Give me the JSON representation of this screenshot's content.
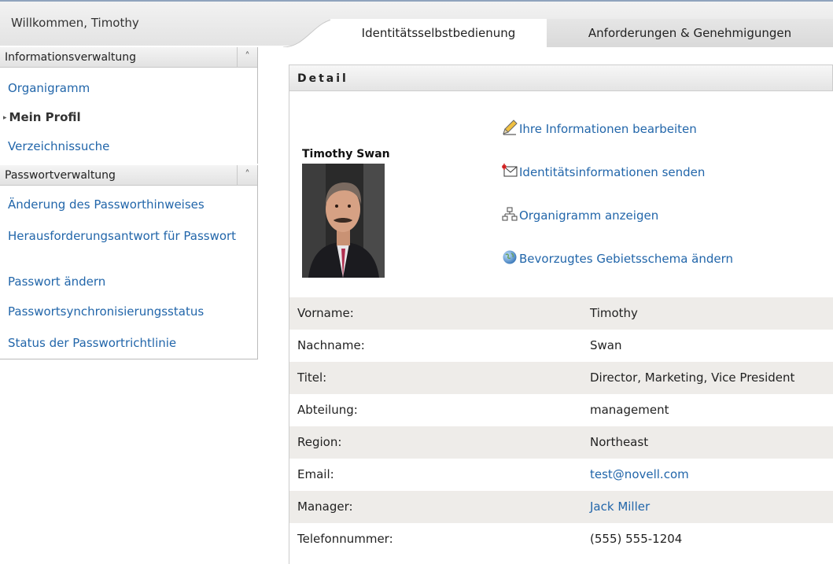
{
  "header": {
    "welcome": "Willkommen, Timothy",
    "tabs": [
      {
        "label": "Identitätsselbstbedienung",
        "active": true
      },
      {
        "label": "Anforderungen & Genehmigungen",
        "active": false
      }
    ]
  },
  "sidebar": {
    "groups": [
      {
        "title": "Informationsverwaltung",
        "items": [
          {
            "label": "Organigramm"
          },
          {
            "label": "Mein Profil",
            "current": true
          },
          {
            "label": "Verzeichnissuche"
          }
        ]
      },
      {
        "title": "Passwortverwaltung",
        "items": [
          {
            "label": "Änderung des Passworthinweises"
          },
          {
            "label": "Herausforderungsantwort für Passwort"
          },
          {
            "label": "Passwort ändern"
          },
          {
            "label": "Passwortsynchronisierungsstatus"
          },
          {
            "label": "Status der Passwortrichtlinie"
          }
        ]
      }
    ]
  },
  "detail": {
    "title": "Detail",
    "person_name": "Timothy Swan",
    "actions": [
      {
        "label": "Ihre Informationen bearbeiten",
        "icon": "pencil-icon"
      },
      {
        "label": "Identitätsinformationen senden",
        "icon": "envelope-icon"
      },
      {
        "label": "Organigramm anzeigen",
        "icon": "org-chart-icon"
      },
      {
        "label": "Bevorzugtes Gebietsschema ändern",
        "icon": "globe-icon"
      }
    ],
    "fields": [
      {
        "label": "Vorname:",
        "value": "Timothy",
        "link": false
      },
      {
        "label": "Nachname:",
        "value": "Swan",
        "link": false
      },
      {
        "label": "Titel:",
        "value": "Director, Marketing, Vice President",
        "link": false
      },
      {
        "label": "Abteilung:",
        "value": "management",
        "link": false
      },
      {
        "label": "Region:",
        "value": "Northeast",
        "link": false
      },
      {
        "label": "Email:",
        "value": "test@novell.com",
        "link": true
      },
      {
        "label": "Manager:",
        "value": "Jack Miller",
        "link": true
      },
      {
        "label": "Telefonnummer:",
        "value": "(555) 555-1204",
        "link": false
      }
    ]
  },
  "colors": {
    "link": "#2266aa",
    "row_alt": "#eeece9"
  }
}
